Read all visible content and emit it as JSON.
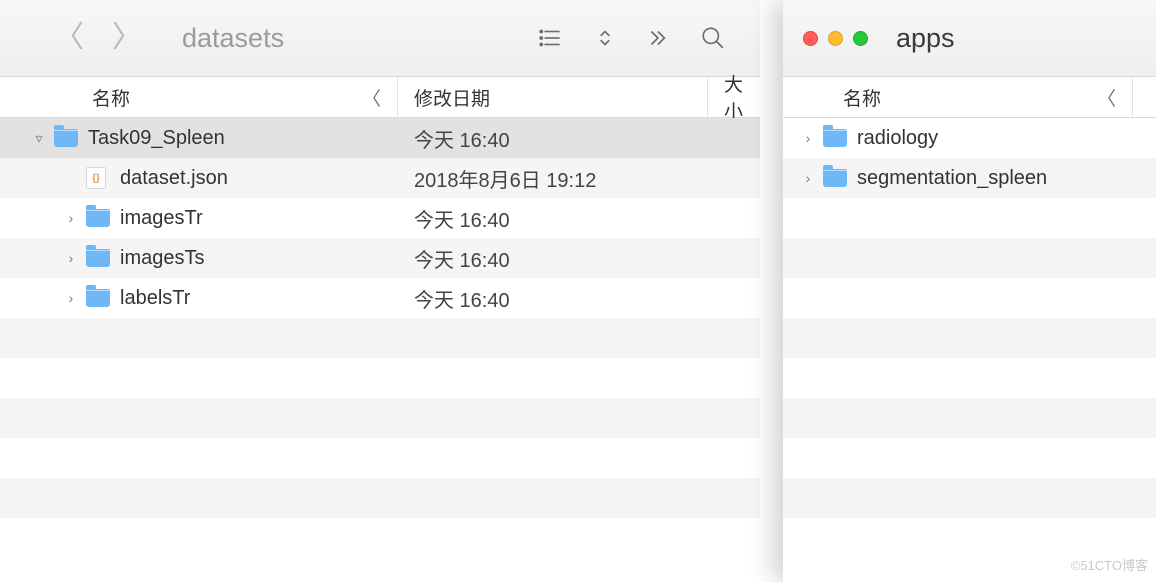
{
  "left": {
    "title": "datasets",
    "columns": {
      "name": "名称",
      "date": "修改日期",
      "size": "大小"
    },
    "rows": [
      {
        "name": "Task09_Spleen",
        "date": "今天 16:40",
        "type": "folder",
        "indent": 0,
        "expanded": true,
        "selected": true
      },
      {
        "name": "dataset.json",
        "date": "2018年8月6日 19:12",
        "type": "file-json",
        "indent": 1,
        "expanded": null,
        "selected": false
      },
      {
        "name": "imagesTr",
        "date": "今天 16:40",
        "type": "folder",
        "indent": 1,
        "expanded": false,
        "selected": false
      },
      {
        "name": "imagesTs",
        "date": "今天 16:40",
        "type": "folder",
        "indent": 1,
        "expanded": false,
        "selected": false
      },
      {
        "name": "labelsTr",
        "date": "今天 16:40",
        "type": "folder",
        "indent": 1,
        "expanded": false,
        "selected": false
      }
    ]
  },
  "right": {
    "title": "apps",
    "columns": {
      "name": "名称"
    },
    "rows": [
      {
        "name": "radiology",
        "type": "folder",
        "expanded": false
      },
      {
        "name": "segmentation_spleen",
        "type": "folder",
        "expanded": false
      }
    ]
  },
  "watermark": "©51CTO博客"
}
